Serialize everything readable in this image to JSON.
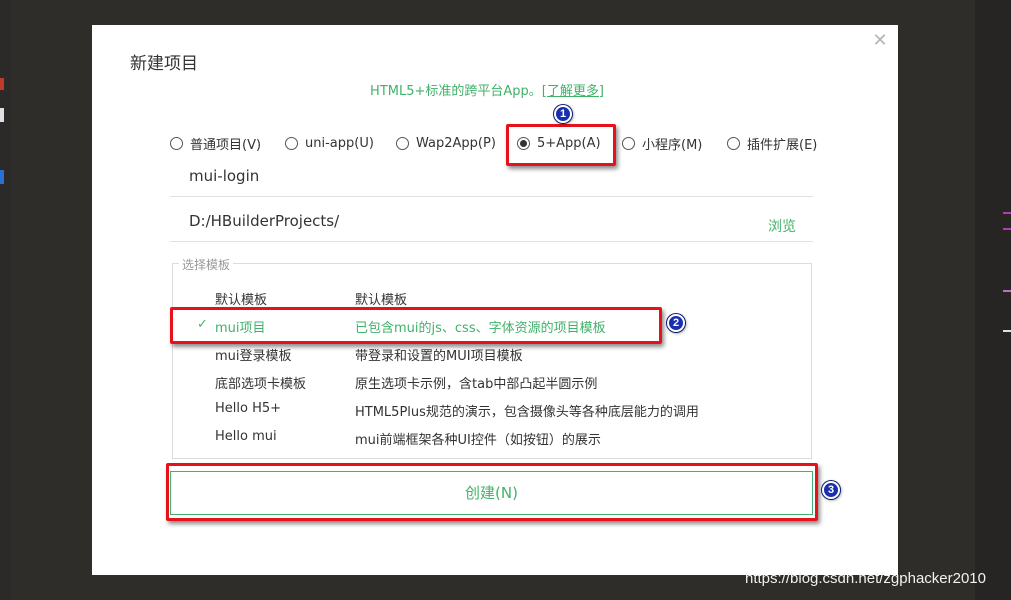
{
  "dialog": {
    "title": "新建项目",
    "close_icon": "close-icon",
    "info_text": "HTML5+标准的跨平台App。",
    "learn_more": "[了解更多]"
  },
  "project_types": [
    {
      "label": "普通项目(V)",
      "selected": false
    },
    {
      "label": "uni-app(U)",
      "selected": false
    },
    {
      "label": "Wap2App(P)",
      "selected": false
    },
    {
      "label": "5+App(A)",
      "selected": true
    },
    {
      "label": "小程序(M)",
      "selected": false
    },
    {
      "label": "插件扩展(E)",
      "selected": false
    }
  ],
  "project_name": {
    "value": "mui-login"
  },
  "project_path": {
    "value": "D:/HBuilderProjects/",
    "browse_label": "浏览"
  },
  "templates": {
    "legend": "选择模板",
    "items": [
      {
        "name": "默认模板",
        "desc": "默认模板",
        "selected": false
      },
      {
        "name": "mui项目",
        "desc": "已包含mui的js、css、字体资源的项目模板",
        "selected": true,
        "check": "✓"
      },
      {
        "name": "mui登录模板",
        "desc": "带登录和设置的MUI项目模板",
        "selected": false
      },
      {
        "name": "底部选项卡模板",
        "desc": "原生选项卡示例，含tab中部凸起半圆示例",
        "selected": false
      },
      {
        "name": "Hello H5+",
        "desc": "HTML5Plus规范的演示，包含摄像头等各种底层能力的调用",
        "selected": false
      },
      {
        "name": "Hello mui",
        "desc": "mui前端框架各种UI控件（如按钮）的展示",
        "selected": false
      }
    ]
  },
  "create_button": {
    "label": "创建(N)"
  },
  "annotations": [
    {
      "number": "1"
    },
    {
      "number": "2"
    },
    {
      "number": "3"
    }
  ],
  "watermark": "https://blog.csdn.net/zgphacker2010",
  "colors": {
    "accent": "#41b26a",
    "callout": "#e8101a",
    "badge": "#1a2fb0",
    "backdrop": "#2f2d2a"
  }
}
